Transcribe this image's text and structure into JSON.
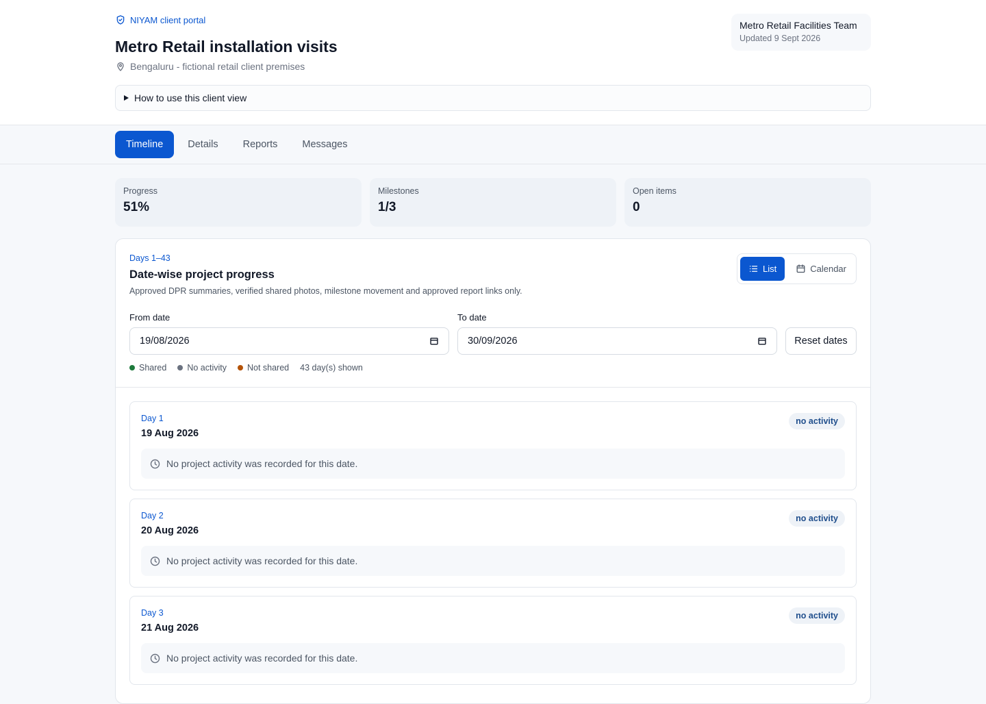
{
  "header": {
    "brand": "NIYAM client portal",
    "title": "Metro Retail installation visits",
    "location": "Bengaluru - fictional retail client premises",
    "team_name": "Metro Retail Facilities Team",
    "updated": "Updated 9 Sept 2026",
    "howto": "How to use this client view"
  },
  "tabs": [
    "Timeline",
    "Details",
    "Reports",
    "Messages"
  ],
  "stats": [
    {
      "label": "Progress",
      "value": "51%"
    },
    {
      "label": "Milestones",
      "value": "1/3"
    },
    {
      "label": "Open items",
      "value": "0"
    }
  ],
  "panel": {
    "range": "Days 1–43",
    "title": "Date-wise project progress",
    "description": "Approved DPR summaries, verified shared photos, milestone movement and approved report links only.",
    "view_list": "List",
    "view_calendar": "Calendar",
    "from_label": "From date",
    "from_value": "19/08/2026",
    "to_label": "To date",
    "to_value": "30/09/2026",
    "reset": "Reset dates",
    "legend": {
      "shared": "Shared",
      "no_activity": "No activity",
      "not_shared": "Not shared",
      "count": "43 day(s) shown"
    },
    "colors": {
      "accent": "#0b57d0",
      "shared": "#1e7a3c",
      "no_activity": "#6b7280",
      "not_shared": "#b45309"
    }
  },
  "days": [
    {
      "day": "Day 1",
      "date": "19 Aug 2026",
      "badge": "no activity",
      "note": "No project activity was recorded for this date."
    },
    {
      "day": "Day 2",
      "date": "20 Aug 2026",
      "badge": "no activity",
      "note": "No project activity was recorded for this date."
    },
    {
      "day": "Day 3",
      "date": "21 Aug 2026",
      "badge": "no activity",
      "note": "No project activity was recorded for this date."
    }
  ]
}
